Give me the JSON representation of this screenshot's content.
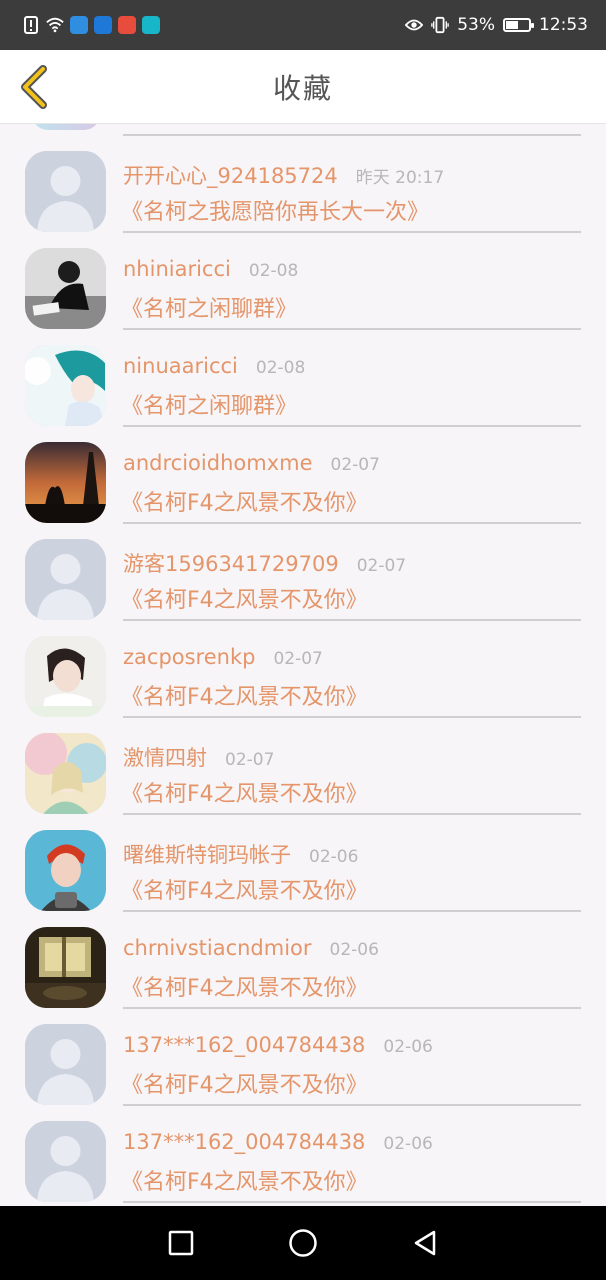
{
  "status_bar": {
    "battery_percent": "53%",
    "battery_level": 0.53,
    "time": "12:53",
    "app_icons": [
      {
        "name": "browser-app-icon",
        "color": "#2f8ee0"
      },
      {
        "name": "zhihu-app-icon",
        "color": "#1e78d8"
      },
      {
        "name": "security-app-icon",
        "color": "#e84c3d"
      },
      {
        "name": "reader-app-icon",
        "color": "#17b6c8"
      }
    ]
  },
  "header": {
    "title": "收藏",
    "accent_color": "#f3c21a"
  },
  "items": [
    {
      "name": "开开心心_924185724",
      "time": "昨天 20:17",
      "group": "《名柯之我愿陪你再长大一次》",
      "avatar": "default"
    },
    {
      "name": "nhiniaricci",
      "time": "02-08",
      "group": "《名柯之闲聊群》",
      "avatar": "photo-dark-desk"
    },
    {
      "name": "ninuaaricci",
      "time": "02-08",
      "group": "《名柯之闲聊群》",
      "avatar": "anime-teal-hair"
    },
    {
      "name": "andrcioidhomxme",
      "time": "02-07",
      "group": "《名柯F4之风景不及你》",
      "avatar": "sunset-eiffel"
    },
    {
      "name": "游客1596341729709",
      "time": "02-07",
      "group": "《名柯F4之风景不及你》",
      "avatar": "default"
    },
    {
      "name": "zacposrenkp",
      "time": "02-07",
      "group": "《名柯F4之风景不及你》",
      "avatar": "girl-photo"
    },
    {
      "name": "激情四射",
      "time": "02-07",
      "group": "《名柯F4之风景不及你》",
      "avatar": "pastel-illustration"
    },
    {
      "name": "曙维斯特铜玛帐子",
      "time": "02-06",
      "group": "《名柯F4之风景不及你》",
      "avatar": "red-hair-portrait"
    },
    {
      "name": "chrnivstiacndmior",
      "time": "02-06",
      "group": "《名柯F4之风景不及你》",
      "avatar": "vintage-room"
    },
    {
      "name": "137***162_004784438",
      "time": "02-06",
      "group": "《名柯F4之风景不及你》",
      "avatar": "default"
    },
    {
      "name": "137***162_004784438",
      "time": "02-06",
      "group": "《名柯F4之风景不及你》",
      "avatar": "default"
    }
  ],
  "colors": {
    "name_text": "#e5956a",
    "time_text": "#b7b7b7",
    "divider": "#cfcfcf"
  },
  "nav_bar": {
    "buttons": [
      "recent-apps",
      "home",
      "back"
    ]
  }
}
